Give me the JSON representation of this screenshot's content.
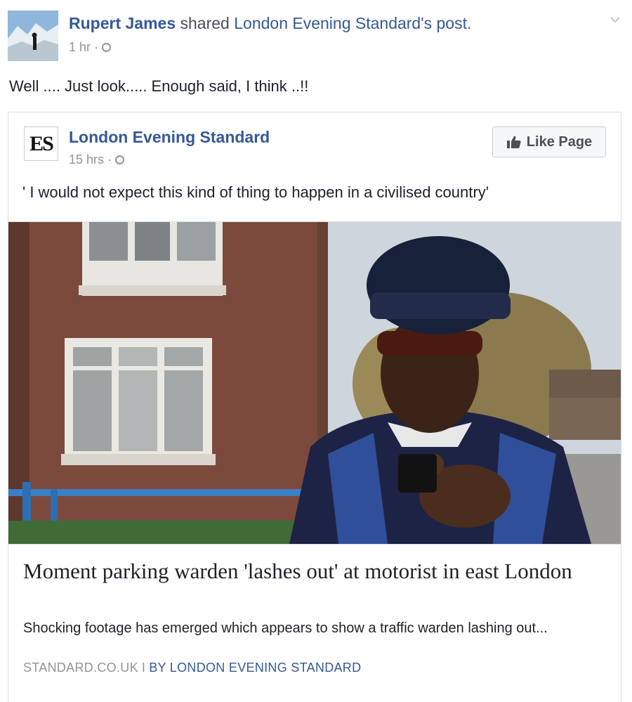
{
  "post": {
    "author": "Rupert James",
    "shared_text": "shared",
    "shared_page": "London Evening Standard's post.",
    "time": "1 hr",
    "dot": "·",
    "text": "Well .... Just look..... Enough said, I think ..!!"
  },
  "shared": {
    "logo_text": "ES",
    "page_name": "London Evening Standard",
    "time": "15 hrs",
    "dot": "·",
    "like_page_label": "Like Page",
    "quote": "' I would not expect this kind of thing to happen in a civilised country'"
  },
  "link": {
    "title": "Moment parking warden 'lashes out' at motorist in east London",
    "description": "Shocking footage has emerged which appears to show a traffic warden lashing out...",
    "domain": "STANDARD.CO.UK",
    "separator": "I",
    "by": "BY LONDON EVENING STANDARD"
  },
  "colors": {
    "link_blue": "#365899",
    "meta_gray": "#90949c",
    "border": "#dddfe2"
  },
  "icons": {
    "globe": "globe-icon",
    "like": "thumbs-up-icon",
    "chevron": "chevron-down-icon"
  }
}
